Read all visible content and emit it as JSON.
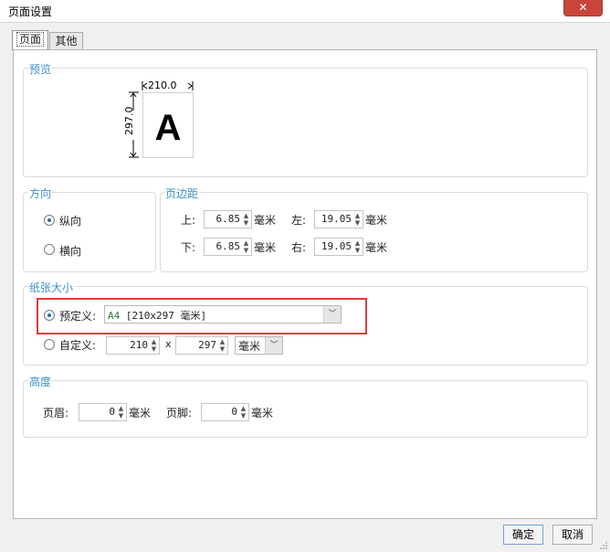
{
  "window": {
    "title": "页面设置",
    "close_glyph": "✕"
  },
  "tabs": [
    {
      "label": "页面"
    },
    {
      "label": "其他"
    }
  ],
  "preview": {
    "label": "预览",
    "width_label": "210.0",
    "height_label": "297.0",
    "letter": "A"
  },
  "orientation": {
    "label": "方向",
    "portrait": "纵向",
    "landscape": "横向",
    "selected": "portrait"
  },
  "margins": {
    "label": "页边距",
    "top": {
      "label": "上:",
      "value": "6.85",
      "unit": "毫米"
    },
    "left": {
      "label": "左:",
      "value": "19.05",
      "unit": "毫米"
    },
    "bottom": {
      "label": "下:",
      "value": "6.85",
      "unit": "毫米"
    },
    "right": {
      "label": "右:",
      "value": "19.05",
      "unit": "毫米"
    }
  },
  "paper_size": {
    "label": "纸张大小",
    "predefined_label": "预定义:",
    "predefined_value_code": "A4",
    "predefined_value_rest": " [210x297 毫米]",
    "custom_label": "自定义:",
    "custom_width": "210",
    "times": "x",
    "custom_height": "297",
    "custom_unit": "毫米",
    "selected": "predefined"
  },
  "height": {
    "label": "高度",
    "header_label": "页眉:",
    "header_value": "0",
    "header_unit": "毫米",
    "footer_label": "页脚:",
    "footer_value": "0",
    "footer_unit": "毫米"
  },
  "buttons": {
    "ok": "确定",
    "cancel": "取消"
  },
  "colors": {
    "group_label": "#3a8fc9",
    "highlight_box": "#e23b3b",
    "close_button": "#c8453b"
  }
}
